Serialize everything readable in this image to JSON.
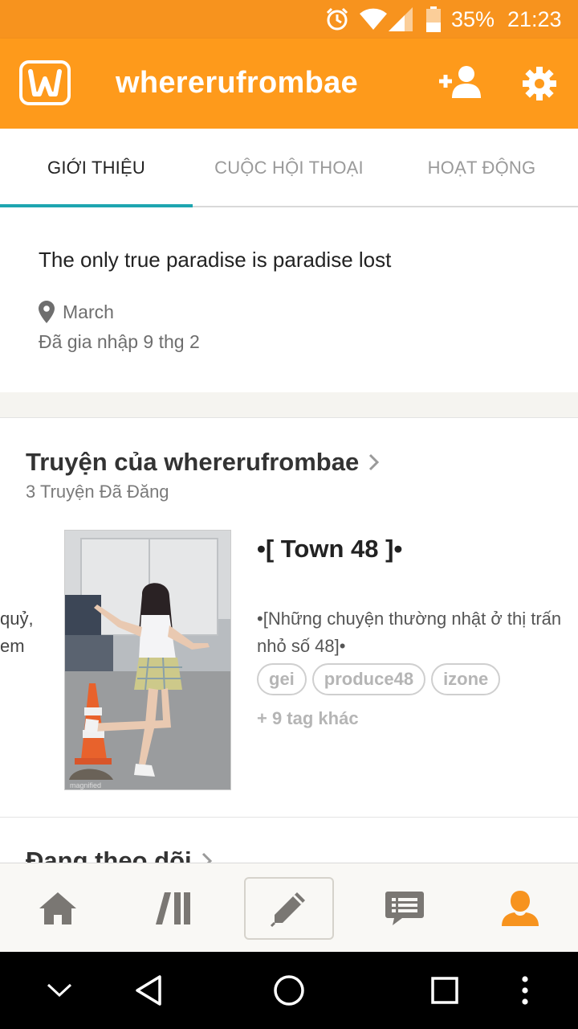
{
  "status_bar": {
    "battery": "35%",
    "time": "21:23"
  },
  "app_bar": {
    "username": "whererufrombae"
  },
  "tabs": [
    {
      "label": "GIỚI THIỆU"
    },
    {
      "label": "CUỘC HỘI THOẠI"
    },
    {
      "label": "HOẠT ĐỘNG"
    }
  ],
  "about": {
    "bio": "The only true paradise is paradise lost",
    "location": "March",
    "joined": "Đã gia nhập 9 thg 2"
  },
  "stories": {
    "title": "Truyện của whererufrombae",
    "count": "3 Truyện Đã Đăng",
    "prev_snippet_line1": "quỷ,",
    "prev_snippet_line2": "em",
    "item": {
      "title": "•[ Town 48 ]•",
      "description": "•[Những chuyện thường nhật ở thị trấn nhỏ số 48]•",
      "tags": [
        "gei",
        "produce48",
        "izone"
      ],
      "more_tags": "+ 9 tag khác"
    }
  },
  "following": {
    "title": "Đang theo dõi"
  },
  "colors": {
    "brand": "#fe9a1b",
    "tab_accent": "#1da5b0",
    "nav_active": "#f7931e",
    "nav_inactive": "#7a7773"
  },
  "bottom_nav": {
    "items": [
      "home-icon",
      "library-icon",
      "write-icon",
      "messages-icon",
      "profile-icon"
    ],
    "active": "profile-icon"
  }
}
